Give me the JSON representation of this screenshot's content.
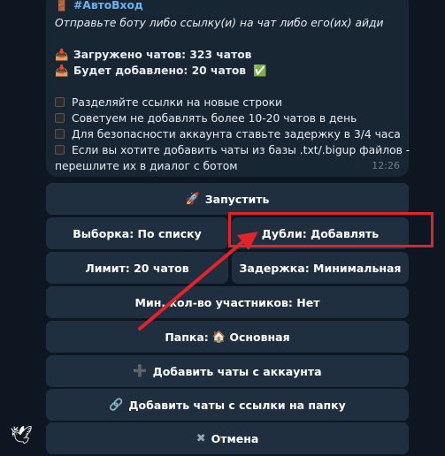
{
  "message": {
    "header_icon": "door-icon",
    "title": "#АвтоВход",
    "subtitle": "Отправьте боту либо ссылку(и) на чат либо его(их) айди",
    "loaded_label": "Загружено чатов: 323 чатов",
    "added_label": "Будет добавлено: 20 чатов",
    "tips": [
      "Разделяйте ссылки на новые строки",
      "Советуем не добавлять более 10-20 чатов в день",
      "Для безопасности аккаунта ставьте задержку в 3/4 часа",
      "Если вы хотите добавить чаты из базы .txt/.bigup файлов -",
      "перешлите их в диалог с ботом"
    ],
    "time": "12:26"
  },
  "keyboard": {
    "start": "Запустить",
    "selection": "Выборка: По списку",
    "duplicates": "Дубли: Добавлять",
    "limit": "Лимит: 20 чатов",
    "delay": "Задержка: Минимальная",
    "min_members": "Мин. кол-во участников: Нет",
    "folder_prefix": "Папка:",
    "folder_value": "Основная",
    "add_from_account": "Добавить чаты с аккаунта",
    "add_from_folder_link": "Добавить чаты с ссылки на папку",
    "cancel": "Отмена"
  },
  "colors": {
    "background": "#0e1621",
    "bubble": "#182533",
    "button": "#1f2f3f",
    "accent": "#6ab2f2",
    "highlight": "#e0242a"
  }
}
